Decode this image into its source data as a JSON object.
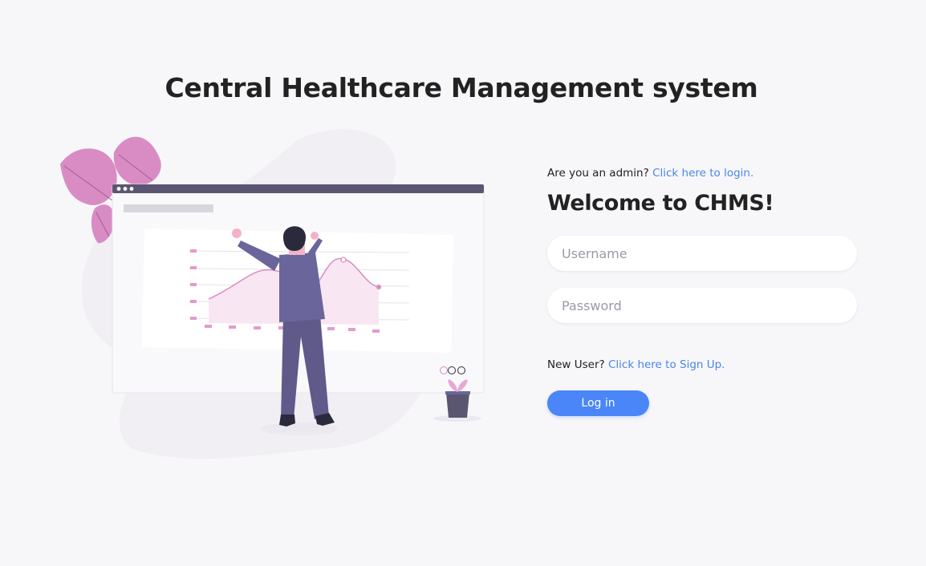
{
  "header": {
    "title": "Central Healthcare Management system"
  },
  "login": {
    "admin_prompt": "Are you an admin?",
    "admin_link": "Click here to login.",
    "welcome": "Welcome to CHMS!",
    "username_placeholder": "Username",
    "password_placeholder": "Password",
    "signup_prompt": "New User?",
    "signup_link": "Click here to Sign Up.",
    "login_button": "Log in"
  },
  "colors": {
    "background": "#f7f7f9",
    "link": "#4a86e8",
    "button": "#4a86f7",
    "accent_pink": "#d98cc4",
    "figure_purple": "#5f5a8a"
  }
}
